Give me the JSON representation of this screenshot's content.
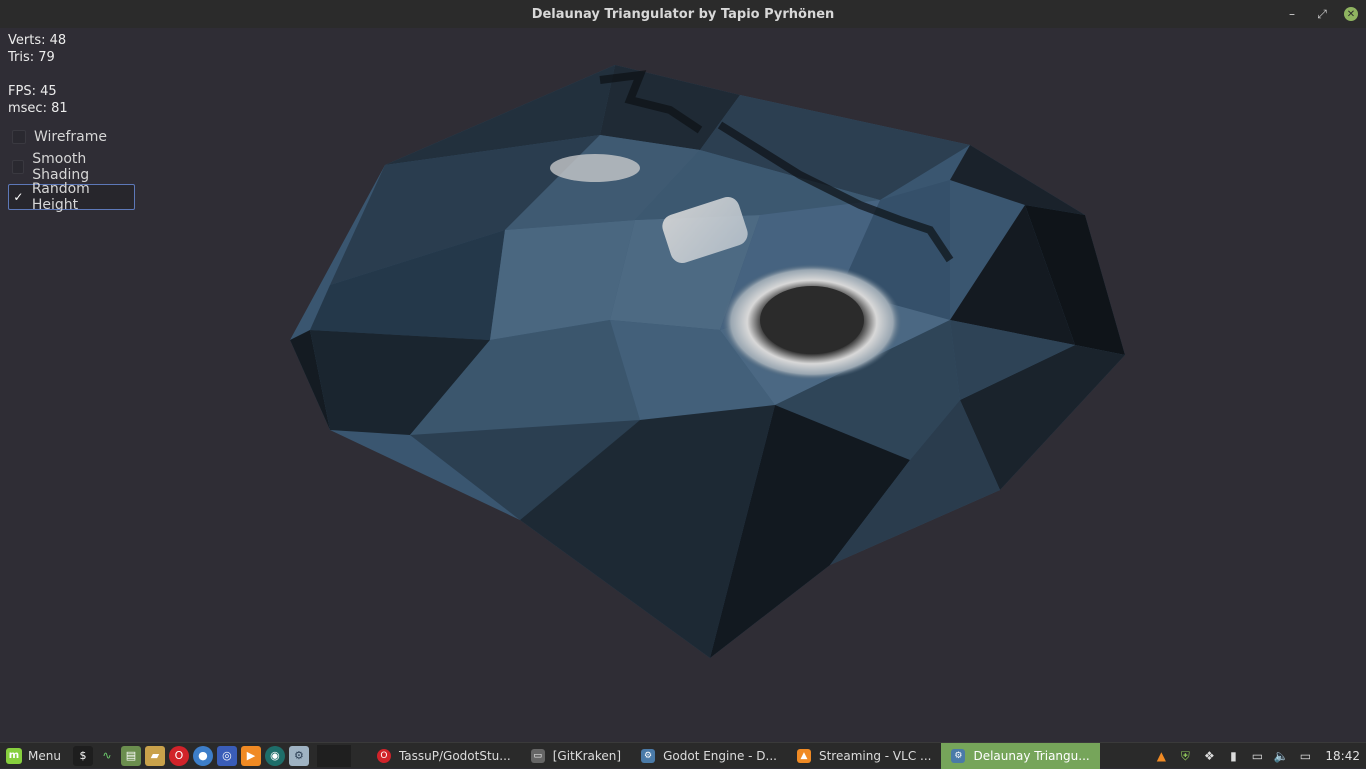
{
  "window": {
    "title": "Delaunay Triangulator by Tapio Pyrhönen",
    "minimize_icon": "minimize-icon",
    "restore_icon": "restore-icon",
    "close_icon": "close-icon"
  },
  "stats": {
    "verts": "Verts: 48",
    "tris": "Tris: 79",
    "fps": "FPS: 45",
    "msec": "msec: 81"
  },
  "options": [
    {
      "label": "Wireframe",
      "checked": false
    },
    {
      "label": "Smooth Shading",
      "checked": false
    },
    {
      "label": "Random Height",
      "checked": true,
      "check_mark": "✓"
    }
  ],
  "taskbar": {
    "menu_label": "Menu",
    "launchers": [
      "terminal-icon",
      "system-monitor-icon",
      "files-manager-icon",
      "folder-icon",
      "opera-icon",
      "app-a-icon",
      "app-b-icon",
      "vlc-launcher-icon",
      "gitkraken-launcher-icon",
      "godot-launcher-icon"
    ],
    "tasks": [
      {
        "label": "TassuP/GodotStu...",
        "icon": "opera-icon",
        "active": false
      },
      {
        "label": "[GitKraken]",
        "icon": "window-icon",
        "active": false
      },
      {
        "label": "Godot Engine - D...",
        "icon": "godot-icon",
        "active": false
      },
      {
        "label": "Streaming - VLC ...",
        "icon": "vlc-icon",
        "active": false
      },
      {
        "label": "Delaunay Triangu...",
        "icon": "godot-icon",
        "active": true
      }
    ],
    "tray": [
      "vlc-tray-icon",
      "shield-icon",
      "dropbox-icon",
      "network-icon",
      "display-icon",
      "volume-icon",
      "battery-icon"
    ],
    "clock": "18:42"
  },
  "colors": {
    "background": "#2f2d35",
    "mesh_base": "#3d5a73",
    "active_task": "#76a55a",
    "mint_green": "#87cf3e"
  }
}
